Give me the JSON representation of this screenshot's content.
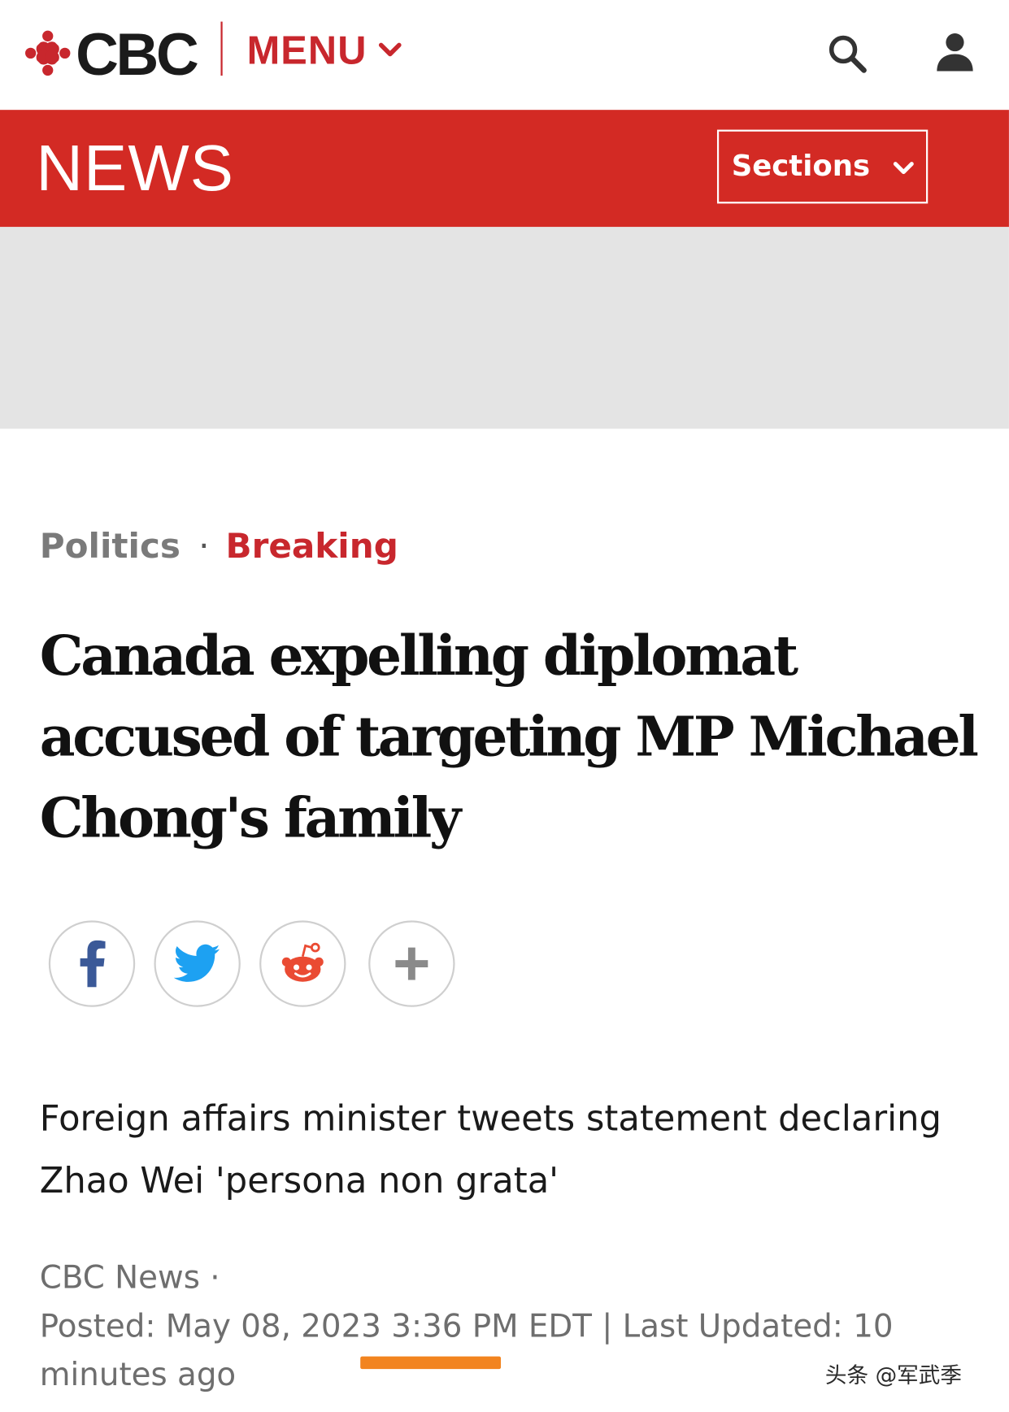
{
  "header": {
    "brand": "CBC",
    "menu_label": "MENU",
    "icons": [
      "cbc-gem-icon",
      "chevron-down-icon",
      "search-icon",
      "user-icon"
    ]
  },
  "news_bar": {
    "title": "NEWS",
    "sections_label": "Sections"
  },
  "article": {
    "breadcrumb": {
      "category": "Politics",
      "separator": "·",
      "tag": "Breaking"
    },
    "headline": "Canada expelling diplomat accused of targeting MP Michael Chong's family",
    "share_icons": [
      "facebook-icon",
      "twitter-icon",
      "reddit-icon",
      "plus-icon"
    ],
    "deck": "Foreign affairs minister tweets statement declaring Zhao Wei 'persona non grata'",
    "byline": "CBC News ·",
    "timestamp": "Posted: May 08, 2023 3:36 PM EDT | Last Updated: 10 minutes ago"
  },
  "watermark": "头条 @军武季",
  "colors": {
    "cbc_red": "#d32a24",
    "menu_red": "#c8272d",
    "ad_gray": "#e4e4e4",
    "highlight_orange": "#f2841f"
  }
}
